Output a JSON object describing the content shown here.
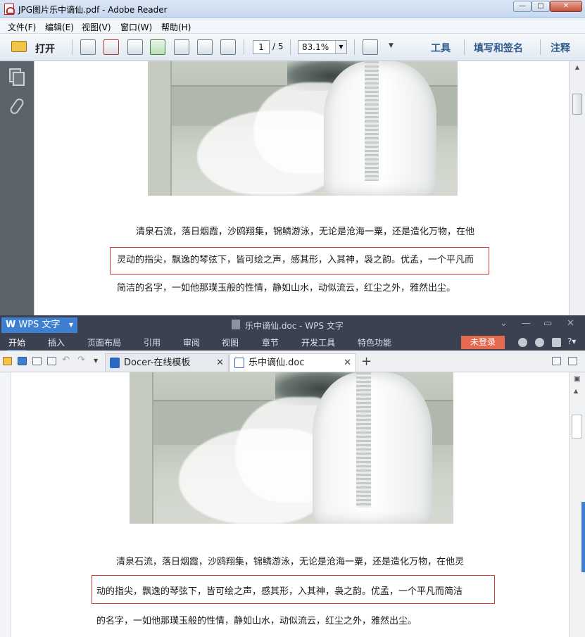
{
  "reader": {
    "title": "JPG图片乐中谪仙.pdf - Adobe Reader",
    "menu": [
      "文件(F)",
      "编辑(E)",
      "视图(V)",
      "窗口(W)",
      "帮助(H)"
    ],
    "toolbar": {
      "open_label": "打开",
      "page_current": "1",
      "page_total": "/ 5",
      "zoom": "83.1%",
      "tools_label": "工具",
      "fill_sign_label": "填写和签名",
      "comment_label": "注释"
    },
    "paragraph": {
      "line1": "清泉石流，落日烟霞，沙鸥翔集，锦鳞游泳，无论是沧海一粟，还是造化万物，在他",
      "line2": "灵动的指尖，飘逸的琴弦下，皆可绘之声，感其形，入其神，袅之韵。优孟，一个平凡而",
      "line3": "简洁的名字，一如他那璞玉般的性情，静如山水，动似流云，红尘之外，雅然出尘。"
    }
  },
  "wps": {
    "brand": "WPS 文字",
    "title": "乐中谪仙.doc - WPS 文字",
    "ribbon_tabs": [
      "开始",
      "插入",
      "页面布局",
      "引用",
      "审阅",
      "视图",
      "章节",
      "开发工具",
      "特色功能"
    ],
    "login_label": "未登录",
    "doc_tabs": [
      {
        "label": "Docer-在线模板"
      },
      {
        "label": "乐中谪仙.doc"
      }
    ],
    "paragraph": {
      "line1": "清泉石流，落日烟霞，沙鸥翔集，锦鳞游泳，无论是沧海一粟，还是造化万物，在他灵",
      "line2": "动的指尖，飘逸的琴弦下，皆可绘之声，感其形，入其神，袅之韵。优孟，一个平凡而简洁",
      "line3": "的名字，一如他那璞玉般的性情，静如山水，动似流云，红尘之外，雅然出尘。"
    }
  }
}
